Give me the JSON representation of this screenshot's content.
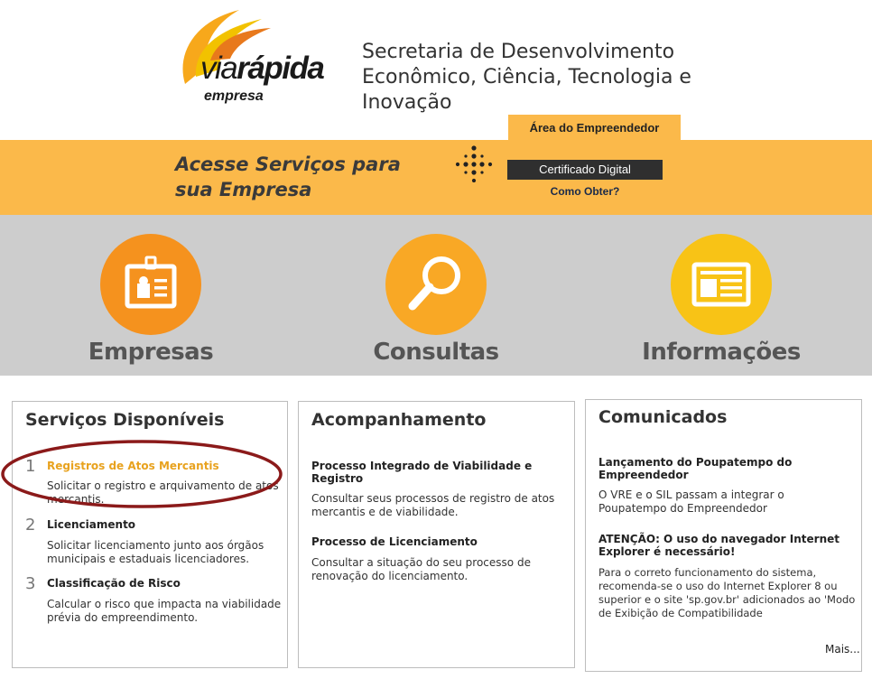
{
  "header": {
    "logo": {
      "prefix": "via",
      "main": "rápida",
      "sub": "empresa"
    },
    "secretaria": "Secretaria de Desenvolvimento Econômico, Ciência, Tecnologia e Inovação",
    "area_tab": "Área do Empreendedor"
  },
  "band": {
    "title_line1": "Acesse Serviços para",
    "title_line2": "sua Empresa",
    "cert_button": "Certificado Digital",
    "como_obter": "Como Obter?"
  },
  "categories": [
    {
      "label": "Empresas",
      "icon": "id-badge-icon",
      "color": "#f5921e"
    },
    {
      "label": "Consultas",
      "icon": "magnifier-icon",
      "color": "#f9a825"
    },
    {
      "label": "Informações",
      "icon": "newspaper-icon",
      "color": "#f8c316"
    }
  ],
  "servicos": {
    "title": "Serviços Disponíveis",
    "items": [
      {
        "num": "1",
        "title": "Registros de Atos Mercantis",
        "desc": "Solicitar o registro e arquivamento de atos mercantis."
      },
      {
        "num": "2",
        "title": "Licenciamento",
        "desc": "Solicitar licenciamento junto aos órgãos municipais e estaduais licenciadores."
      },
      {
        "num": "3",
        "title": "Classificação de Risco",
        "desc": "Calcular o risco que impacta na viabilidade prévia do empreendimento."
      }
    ]
  },
  "acompanhamento": {
    "title": "Acompanhamento",
    "items": [
      {
        "title": "Processo Integrado de Viabilidade e Registro",
        "desc": "Consultar seus processos de registro de atos mercantis e de viabilidade."
      },
      {
        "title": "Processo de Licenciamento",
        "desc": "Consultar a situação do seu processo de renovação do licenciamento."
      }
    ]
  },
  "comunicados": {
    "title": "Comunicados",
    "items": [
      {
        "title": "Lançamento do Poupatempo do Empreendedor",
        "desc": "O VRE e o SIL passam a integrar o Poupatempo do Empreendedor"
      },
      {
        "title": "ATENÇÃO: O uso do navegador Internet Explorer é necessário!",
        "desc": "Para o correto funcionamento do sistema, recomenda-se o uso do Internet Explorer 8 ou superior e o site 'sp.gov.br' adicionados ao 'Modo de Exibição de Compatibilidade"
      }
    ],
    "mais": "Mais..."
  },
  "colors": {
    "band_orange": "#fbb94a",
    "gray_band": "#cdcdcd",
    "active_link": "#e8a21e",
    "highlight_ellipse": "#8b1a1a"
  }
}
